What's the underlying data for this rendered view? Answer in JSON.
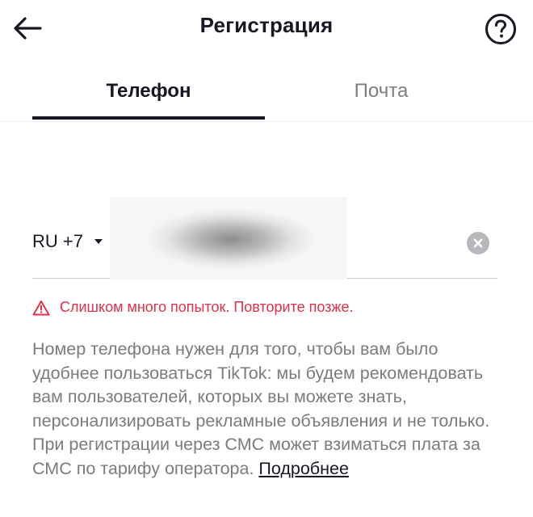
{
  "header": {
    "title": "Регистрация",
    "back_icon": "arrow-left-icon",
    "help_icon": "question-circle-icon"
  },
  "tabs": [
    {
      "label": "Телефон",
      "active": true
    },
    {
      "label": "Почта",
      "active": false
    }
  ],
  "phone": {
    "country_code": "RU +7",
    "value": "",
    "clear_icon": "clear-circle-icon"
  },
  "error": {
    "icon": "warning-triangle-icon",
    "text": "Слишком много попыток. Повторите позже.",
    "color": "#e0304a"
  },
  "info": {
    "text": "Номер телефона нужен для того, чтобы вам было удобнее пользоваться TikTok: мы будем рекомендовать вам пользователей, которых вы можете знать, персонализировать рекламные объявления и не только. При регистрации через СМС может взиматься плата за СМС по тарифу оператора. ",
    "link": "Подробнее"
  }
}
